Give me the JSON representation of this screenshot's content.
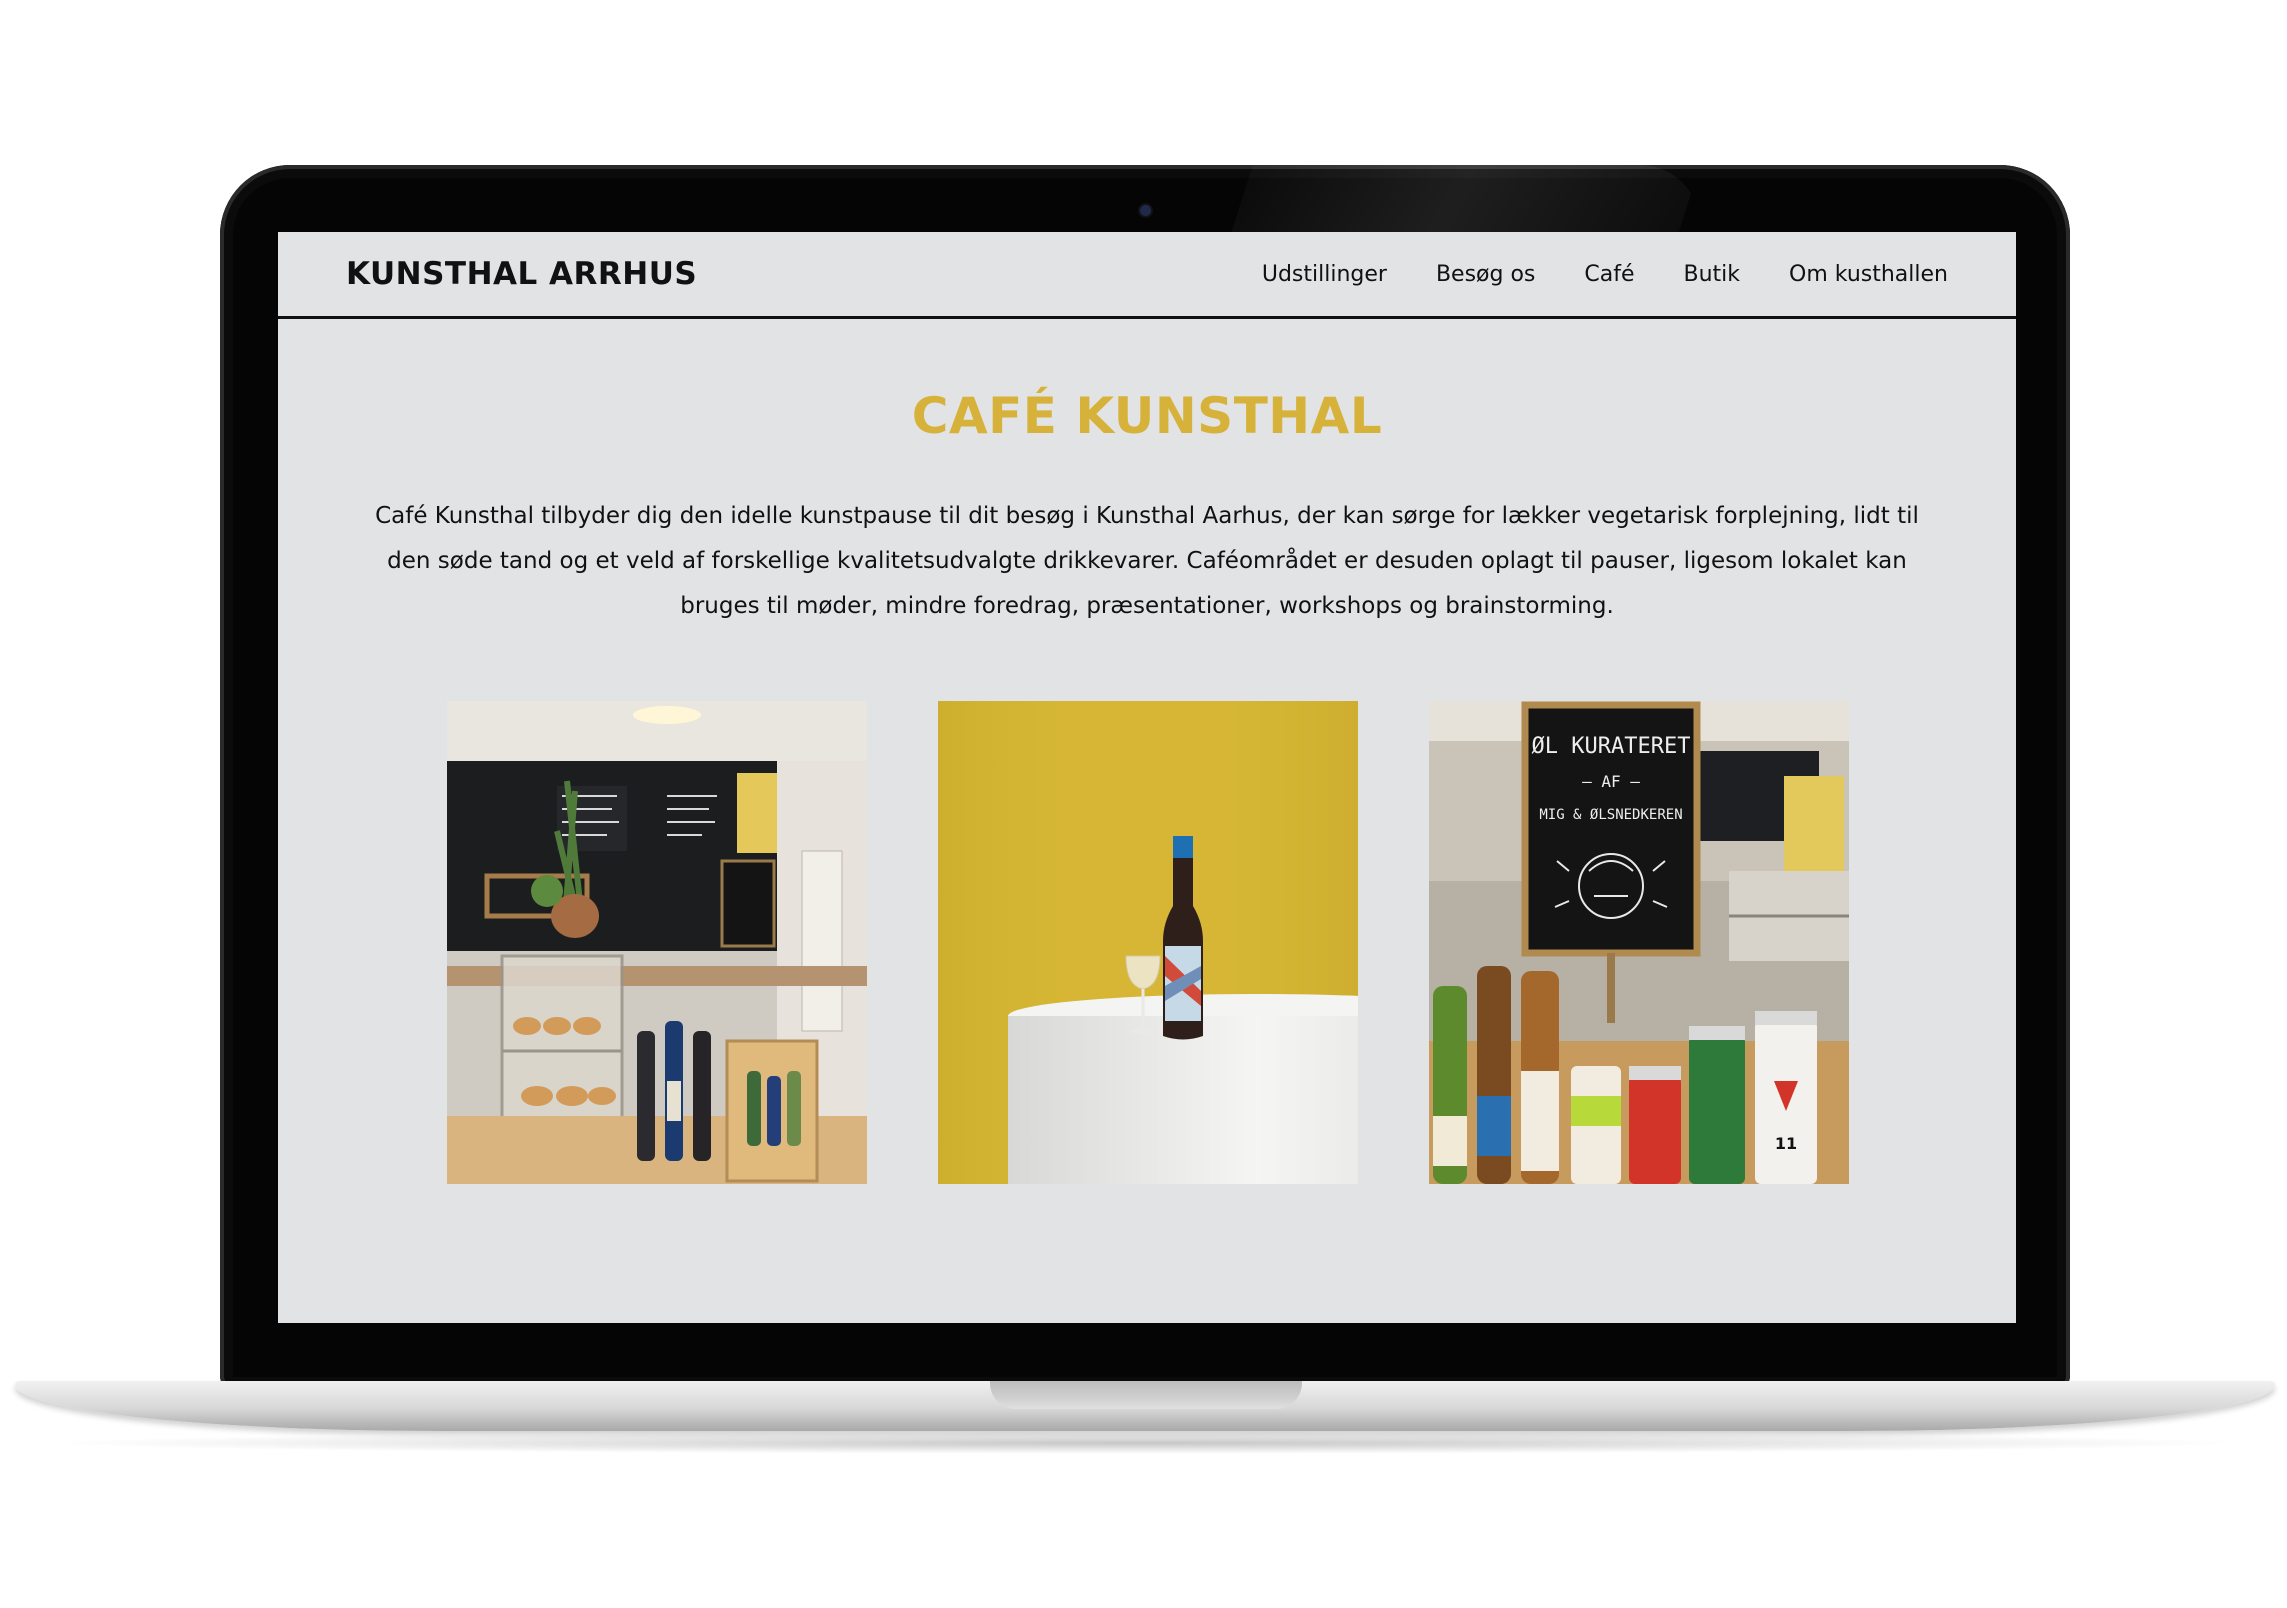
{
  "site": {
    "logo": "KUNSTHAL ARRHUS",
    "nav": [
      "Udstillinger",
      "Besøg os",
      "Café",
      "Butik",
      "Om kusthallen"
    ]
  },
  "page": {
    "title": "CAFÉ KUNSTHAL",
    "intro": "Café Kunsthal tilbyder dig den idelle kunstpause til dit besøg i Kunsthal Aarhus, der kan sørge for lækker vegetarisk forplejning, lidt til den søde tand og et veld af forskellige kvalitetsudvalgte drikkevarer. Caféområdet er desuden oplagt til pauser, ligesom lokalet kan bruges til møder, mindre foredrag, præsentationer, workshops og brainstorming."
  },
  "photos": {
    "chalkboard_text": [
      "ØL KURATERET",
      "— AF —",
      "MIG & ØLSNEDKEREN"
    ],
    "can_label": "11"
  },
  "colors": {
    "title": "#d7b23b",
    "screen_bg": "#e2e3e4",
    "text": "#111111",
    "wall_yellow": "#d6b634"
  }
}
